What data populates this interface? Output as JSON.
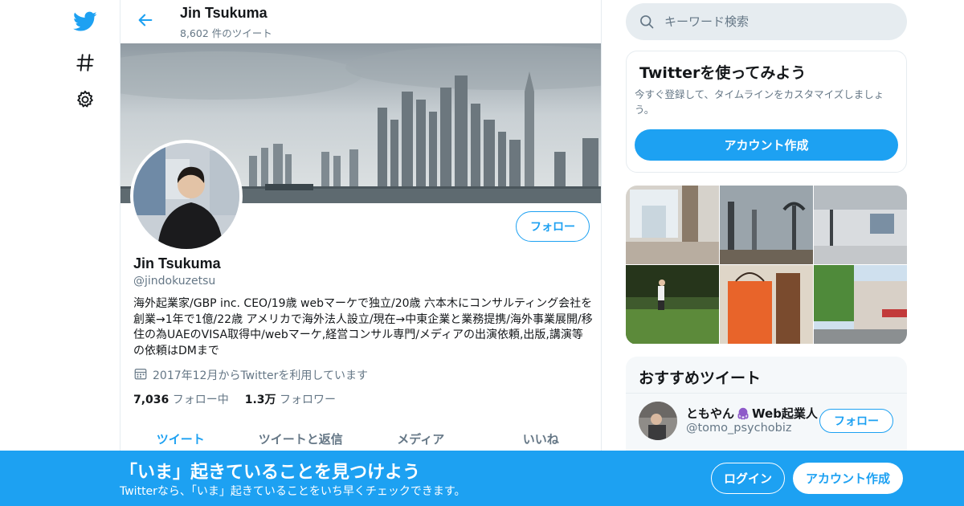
{
  "colors": {
    "accent": "#1da1f2",
    "text": "#14171a",
    "muted": "#657786",
    "border": "#e6ecf0"
  },
  "nav": {
    "icons": [
      "twitter-bird-icon",
      "hashtag-icon",
      "gear-icon"
    ]
  },
  "header": {
    "name": "Jin Tsukuma",
    "tweet_count": "8,602 件のツイート"
  },
  "profile": {
    "name": "Jin Tsukuma",
    "handle": "@jindokuzetsu",
    "follow_label": "フォロー",
    "bio": "海外起業家/GBP inc. CEO/19歳 webマーケで独立/20歳 六本木にコンサルティング会社を創業→1年で1億/22歳 アメリカで海外法人設立/現在→中東企業と業務提携/海外事業展開/移住の為UAEのVISA取得中/webマーケ,経営コンサル専門/メディアの出演依頼,出版,講演等の依頼はDMまで",
    "joined": "2017年12月からTwitterを利用しています",
    "following_count": "7,036",
    "following_label": "フォロー中",
    "followers_count": "1.3万",
    "followers_label": "フォロワー"
  },
  "tabs": [
    {
      "label": "ツイート",
      "active": true
    },
    {
      "label": "ツイートと返信",
      "active": false
    },
    {
      "label": "メディア",
      "active": false
    },
    {
      "label": "いいね",
      "active": false
    }
  ],
  "search": {
    "placeholder": "キーワード検索"
  },
  "signup_card": {
    "title": "Twitterを使ってみよう",
    "text": "今すぐ登録して、タイムラインをカスタマイズしましょう。",
    "button": "アカウント作成"
  },
  "recommended": {
    "title": "おすすめツイート",
    "user_name": "ともやん",
    "user_name_suffix": "Web起業人",
    "user_handle": "@tomo_psychobiz",
    "follow_label": "フォロー"
  },
  "bottom_bar": {
    "title": "「いま」起きていることを見つけよう",
    "subtitle": "Twitterなら、「いま」起きていることをいち早くチェックできます。",
    "login": "ログイン",
    "signup": "アカウント作成"
  }
}
